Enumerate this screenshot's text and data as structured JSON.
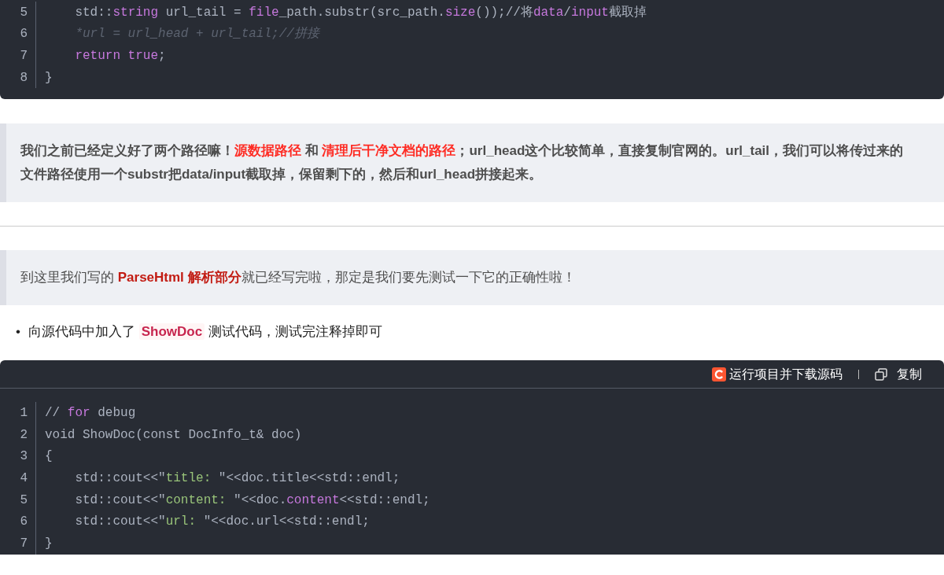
{
  "code_blocks": [
    {
      "lines": [
        {
          "number": "5",
          "tokens": [
            {
              "kind": "plain",
              "text": "    std::"
            },
            {
              "kind": "keyword",
              "text": "string"
            },
            {
              "kind": "plain",
              "text": " url_tail = "
            },
            {
              "kind": "keyword",
              "text": "file"
            },
            {
              "kind": "plain",
              "text": "_path.substr(src_path."
            },
            {
              "kind": "keyword",
              "text": "size"
            },
            {
              "kind": "plain",
              "text": "());//将"
            },
            {
              "kind": "keyword",
              "text": "data"
            },
            {
              "kind": "plain",
              "text": "/"
            },
            {
              "kind": "keyword",
              "text": "input"
            },
            {
              "kind": "plain",
              "text": "截取掉"
            }
          ]
        },
        {
          "number": "6",
          "tokens": [
            {
              "kind": "comment",
              "text": "    *url = url_head + url_tail;//拼接"
            }
          ]
        },
        {
          "number": "7",
          "tokens": [
            {
              "kind": "keyword",
              "text": "    return true"
            },
            {
              "kind": "plain",
              "text": ";"
            }
          ]
        },
        {
          "number": "8",
          "tokens": [
            {
              "kind": "plain",
              "text": "}"
            }
          ]
        }
      ]
    }
  ],
  "quote_1": {
    "bold": true,
    "segments": [
      {
        "kind": "text",
        "text": "我们之前已经定义好了两个路径嘛！"
      },
      {
        "kind": "highlight",
        "text": "源数据路径"
      },
      {
        "kind": "text",
        "text": " 和 "
      },
      {
        "kind": "highlight",
        "text": "清理后干净文档的路径"
      },
      {
        "kind": "text",
        "text": "；url_head这个比较简单，直接复制官网的。url_tail，我们可以将传过来的文件路径使用一个substr把data/input截取掉，保留剩下的，然后和url_head拼接起来。"
      }
    ]
  },
  "quote_2": {
    "bold": false,
    "segments": [
      {
        "kind": "text",
        "text": "到这里我们写的 "
      },
      {
        "kind": "strong",
        "text": "ParseHtml 解析部分"
      },
      {
        "kind": "text",
        "text": "就已经写完啦，那定是我们要先测试一下它的正确性啦！"
      }
    ]
  },
  "bullets": [
    {
      "marker": "•",
      "segments": [
        {
          "kind": "text",
          "text": "向源代码中加入了 "
        },
        {
          "kind": "code",
          "text": "ShowDoc"
        },
        {
          "kind": "text",
          "text": " 测试代码，测试完注释掉即可"
        }
      ]
    }
  ],
  "code_block_2": {
    "toolbar": {
      "run_label": "运行项目并下载源码",
      "copy_label": "复制"
    },
    "lines": [
      {
        "number": "1",
        "tokens": [
          {
            "kind": "plain",
            "text": "// "
          },
          {
            "kind": "keyword",
            "text": "for"
          },
          {
            "kind": "plain",
            "text": " debug"
          }
        ]
      },
      {
        "number": "2",
        "tokens": [
          {
            "kind": "plain",
            "text": "void ShowDoc(const DocInfo_t& doc)"
          }
        ]
      },
      {
        "number": "3",
        "tokens": [
          {
            "kind": "plain",
            "text": "{"
          }
        ]
      },
      {
        "number": "4",
        "tokens": [
          {
            "kind": "plain",
            "text": "    std::cout<<\""
          },
          {
            "kind": "string",
            "text": "title: "
          },
          {
            "kind": "plain",
            "text": "\"<<doc.title<<std::endl;"
          }
        ]
      },
      {
        "number": "5",
        "tokens": [
          {
            "kind": "plain",
            "text": "    std::cout<<\""
          },
          {
            "kind": "string",
            "text": "content: "
          },
          {
            "kind": "plain",
            "text": "\"<<doc."
          },
          {
            "kind": "keyword",
            "text": "content"
          },
          {
            "kind": "plain",
            "text": "<<std::endl;"
          }
        ]
      },
      {
        "number": "6",
        "tokens": [
          {
            "kind": "plain",
            "text": "    std::cout<<\""
          },
          {
            "kind": "string",
            "text": "url: "
          },
          {
            "kind": "plain",
            "text": "\"<<doc.url<<std::endl;"
          }
        ]
      },
      {
        "number": "7",
        "tokens": [
          {
            "kind": "plain",
            "text": "}"
          }
        ]
      }
    ]
  }
}
